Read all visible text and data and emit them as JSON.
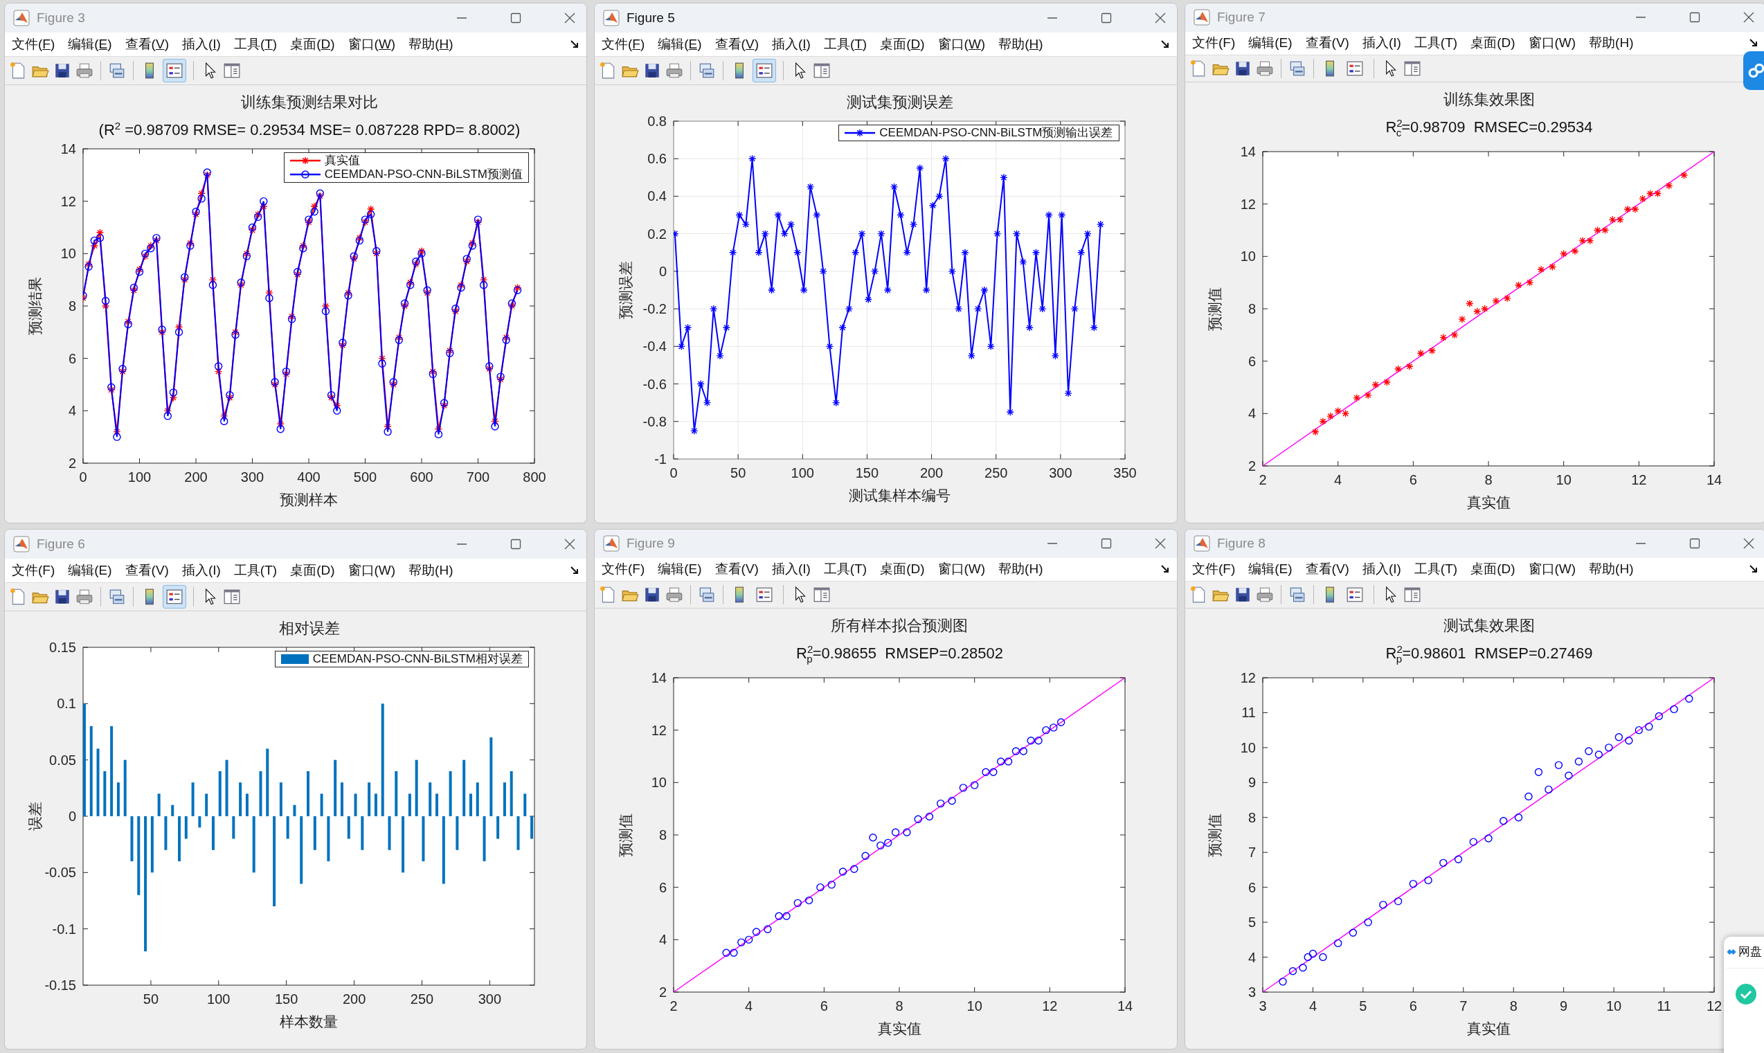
{
  "windows": [
    {
      "title": "Figure 3",
      "active": false,
      "menu_underlined": true,
      "legend_button_selected": true,
      "menu": [
        "文件(F)",
        "编辑(E)",
        "查看(V)",
        "插入(I)",
        "工具(T)",
        "桌面(D)",
        "窗口(W)",
        "帮助(H)"
      ],
      "chart_data": {
        "type": "line",
        "title": "训练集预测结果对比",
        "subtitle": "(R$^{2}$ =0.98709 RMSE= 0.29534 MSE= 0.087228 RPD= 8.8002)",
        "xlabel": "预测样本",
        "ylabel": "预测结果",
        "xlim": [
          0,
          800
        ],
        "ylim": [
          2,
          14
        ],
        "xticks": [
          0,
          100,
          200,
          300,
          400,
          500,
          600,
          700,
          800
        ],
        "yticks": [
          2,
          4,
          6,
          8,
          10,
          12,
          14
        ],
        "grid": false,
        "x": [
          0,
          10,
          20,
          30,
          40,
          50,
          60,
          70,
          80,
          90,
          100,
          110,
          120,
          130,
          140,
          150,
          160,
          170,
          180,
          190,
          200,
          210,
          220,
          230,
          240,
          250,
          260,
          270,
          280,
          290,
          300,
          310,
          320,
          330,
          340,
          350,
          360,
          370,
          380,
          390,
          400,
          410,
          420,
          430,
          440,
          450,
          460,
          470,
          480,
          490,
          500,
          510,
          520,
          530,
          540,
          550,
          560,
          570,
          580,
          590,
          600,
          610,
          620,
          630,
          640,
          650,
          660,
          670,
          680,
          690,
          700,
          710,
          720,
          730,
          740,
          750,
          760,
          770
        ],
        "series": [
          {
            "name": "真实值",
            "color": "#ff0000",
            "marker": "cross",
            "values": [
              8.3,
              9.6,
              10.3,
              10.8,
              8.0,
              4.8,
              3.2,
              5.5,
              7.4,
              8.6,
              9.4,
              9.9,
              10.3,
              10.5,
              7.0,
              4.0,
              4.5,
              7.2,
              9.0,
              10.4,
              11.5,
              12.3,
              13.0,
              9.0,
              5.5,
              3.8,
              4.5,
              7.0,
              8.8,
              10.0,
              10.9,
              11.5,
              11.8,
              8.5,
              5.0,
              3.5,
              5.4,
              7.6,
              9.2,
              10.3,
              11.2,
              11.8,
              12.2,
              8.0,
              4.5,
              4.2,
              6.5,
              8.5,
              9.8,
              10.6,
              11.2,
              11.7,
              10.0,
              6.0,
              3.4,
              5.0,
              6.8,
              8.0,
              8.9,
              9.6,
              10.1,
              8.5,
              5.5,
              3.3,
              4.2,
              6.3,
              7.8,
              8.8,
              9.7,
              10.4,
              11.2,
              9.0,
              5.6,
              3.6,
              5.2,
              6.8,
              8.0,
              8.7
            ]
          },
          {
            "name": "CEEMDAN-PSO-CNN-BiLSTM预测值",
            "color": "#0000ff",
            "marker": "circle",
            "values": [
              8.4,
              9.5,
              10.5,
              10.6,
              8.2,
              4.9,
              3.0,
              5.6,
              7.3,
              8.7,
              9.3,
              10.0,
              10.2,
              10.6,
              7.1,
              3.8,
              4.7,
              7.0,
              9.1,
              10.3,
              11.6,
              12.1,
              13.1,
              8.8,
              5.7,
              3.6,
              4.6,
              6.9,
              8.9,
              9.9,
              11.0,
              11.4,
              12.0,
              8.3,
              5.1,
              3.3,
              5.5,
              7.5,
              9.3,
              10.2,
              11.3,
              11.6,
              12.3,
              7.8,
              4.6,
              4.0,
              6.6,
              8.4,
              9.9,
              10.5,
              11.3,
              11.5,
              10.1,
              5.8,
              3.2,
              5.1,
              6.7,
              8.1,
              8.8,
              9.7,
              10.0,
              8.6,
              5.4,
              3.1,
              4.3,
              6.2,
              7.9,
              8.7,
              9.8,
              10.3,
              11.3,
              8.8,
              5.7,
              3.4,
              5.3,
              6.7,
              8.1,
              8.6
            ]
          }
        ]
      }
    },
    {
      "title": "Figure 5",
      "active": true,
      "menu_underlined": true,
      "legend_button_selected": true,
      "menu": [
        "文件(F)",
        "编辑(E)",
        "查看(V)",
        "插入(I)",
        "工具(T)",
        "桌面(D)",
        "窗口(W)",
        "帮助(H)"
      ],
      "chart_data": {
        "type": "line",
        "title": "测试集预测误差",
        "xlabel": "测试集样本编号",
        "ylabel": "预测误差",
        "xlim": [
          0,
          350
        ],
        "ylim": [
          -1,
          0.8
        ],
        "xticks": [
          0,
          50,
          100,
          150,
          200,
          250,
          300,
          350
        ],
        "yticks": [
          -1,
          -0.8,
          -0.6,
          -0.4,
          -0.2,
          0,
          0.2,
          0.4,
          0.6,
          0.8
        ],
        "grid": true,
        "x": [
          1,
          6,
          11,
          16,
          21,
          26,
          31,
          36,
          41,
          46,
          51,
          56,
          61,
          66,
          71,
          76,
          81,
          86,
          91,
          96,
          101,
          106,
          111,
          116,
          121,
          126,
          131,
          136,
          141,
          146,
          151,
          156,
          161,
          166,
          171,
          176,
          181,
          186,
          191,
          196,
          201,
          206,
          211,
          216,
          221,
          226,
          231,
          236,
          241,
          246,
          251,
          256,
          261,
          266,
          271,
          276,
          281,
          286,
          291,
          296,
          301,
          306,
          311,
          316,
          321,
          326,
          331
        ],
        "series": [
          {
            "name": "CEEMDAN-PSO-CNN-BiLSTM预测输出误差",
            "color": "#0000ff",
            "marker": "cross",
            "values": [
              0.2,
              -0.4,
              -0.3,
              -0.85,
              -0.6,
              -0.7,
              -0.2,
              -0.45,
              -0.3,
              0.1,
              0.3,
              0.25,
              0.6,
              0.1,
              0.2,
              -0.1,
              0.3,
              0.2,
              0.25,
              0.1,
              -0.1,
              0.45,
              0.3,
              0.0,
              -0.4,
              -0.7,
              -0.3,
              -0.2,
              0.1,
              0.2,
              -0.15,
              0.0,
              0.2,
              -0.1,
              0.45,
              0.3,
              0.1,
              0.25,
              0.55,
              -0.1,
              0.35,
              0.4,
              0.6,
              0.0,
              -0.2,
              0.1,
              -0.45,
              -0.2,
              -0.1,
              -0.4,
              0.2,
              0.5,
              -0.75,
              0.2,
              0.05,
              -0.3,
              0.1,
              -0.2,
              0.3,
              -0.45,
              0.3,
              -0.65,
              -0.2,
              0.1,
              0.2,
              -0.3,
              0.25
            ]
          }
        ]
      }
    },
    {
      "title": "Figure 7",
      "active": false,
      "menu_underlined": false,
      "legend_button_selected": false,
      "menu": [
        "文件(F)",
        "编辑(E)",
        "查看(V)",
        "插入(I)",
        "工具(T)",
        "桌面(D)",
        "窗口(W)",
        "帮助(H)"
      ],
      "chart_data": {
        "type": "scatter",
        "title": "训练集效果图",
        "subtitle": "R$^{2}$$_{c}$=0.98709  RMSEC=0.29534",
        "xlabel": "真实值",
        "ylabel": "预测值",
        "xlim": [
          2,
          14
        ],
        "ylim": [
          2,
          14
        ],
        "xticks": [
          2,
          4,
          6,
          8,
          10,
          12,
          14
        ],
        "yticks": [
          2,
          4,
          6,
          8,
          10,
          12,
          14
        ],
        "grid": false,
        "x": [
          3.4,
          3.6,
          3.8,
          4.0,
          4.2,
          4.5,
          4.8,
          5.0,
          5.3,
          5.6,
          5.9,
          6.2,
          6.5,
          6.8,
          7.1,
          7.3,
          7.5,
          7.7,
          7.9,
          8.2,
          8.5,
          8.8,
          9.1,
          9.4,
          9.7,
          10.0,
          10.3,
          10.5,
          10.7,
          10.9,
          11.1,
          11.3,
          11.5,
          11.7,
          11.9,
          12.1,
          12.3,
          12.5,
          12.8,
          13.2
        ],
        "series": [
          {
            "color": "#ff0000",
            "marker": "cross",
            "values": [
              3.3,
              3.7,
              3.9,
              4.1,
              4.0,
              4.6,
              4.7,
              5.1,
              5.2,
              5.7,
              5.8,
              6.3,
              6.4,
              6.9,
              7.0,
              7.6,
              8.2,
              7.9,
              8.0,
              8.3,
              8.4,
              8.9,
              9.0,
              9.5,
              9.6,
              10.1,
              10.2,
              10.6,
              10.6,
              11.0,
              11.0,
              11.4,
              11.4,
              11.8,
              11.8,
              12.2,
              12.4,
              12.4,
              12.7,
              13.1
            ]
          },
          {
            "type": "line",
            "color": "#ff00ff",
            "marker": "none",
            "x": [
              2,
              14
            ],
            "values": [
              2,
              14
            ]
          }
        ]
      }
    },
    {
      "title": "Figure 6",
      "active": false,
      "menu_underlined": false,
      "legend_button_selected": true,
      "menu": [
        "文件(F)",
        "编辑(E)",
        "查看(V)",
        "插入(I)",
        "工具(T)",
        "桌面(D)",
        "窗口(W)",
        "帮助(H)"
      ],
      "chart_data": {
        "type": "bar",
        "title": "相对误差",
        "xlabel": "样本数量",
        "ylabel": "误差",
        "xlim": [
          0,
          333
        ],
        "ylim": [
          -0.15,
          0.15
        ],
        "xticks": [
          50,
          100,
          150,
          200,
          250,
          300
        ],
        "yticks": [
          -0.15,
          -0.1,
          -0.05,
          0,
          0.05,
          0.1,
          0.15
        ],
        "grid": false,
        "x": [
          1,
          6,
          11,
          16,
          21,
          26,
          31,
          36,
          41,
          46,
          51,
          56,
          61,
          66,
          71,
          76,
          81,
          86,
          91,
          96,
          101,
          106,
          111,
          116,
          121,
          126,
          131,
          136,
          141,
          146,
          151,
          156,
          161,
          166,
          171,
          176,
          181,
          186,
          191,
          196,
          201,
          206,
          211,
          216,
          221,
          226,
          231,
          236,
          241,
          246,
          251,
          256,
          261,
          266,
          271,
          276,
          281,
          286,
          291,
          296,
          301,
          306,
          311,
          316,
          321,
          326,
          331
        ],
        "series": [
          {
            "name": "CEEMDAN-PSO-CNN-BiLSTM相对误差",
            "color": "#0072bd",
            "values": [
              0.1,
              0.08,
              0.06,
              0.04,
              0.08,
              0.03,
              0.05,
              -0.04,
              -0.07,
              -0.12,
              -0.05,
              0.02,
              -0.03,
              0.01,
              -0.04,
              -0.02,
              0.03,
              -0.01,
              0.02,
              -0.03,
              0.04,
              0.05,
              -0.02,
              0.03,
              0.02,
              -0.05,
              0.04,
              0.06,
              -0.08,
              0.03,
              -0.02,
              0.01,
              -0.06,
              0.04,
              -0.03,
              0.02,
              -0.04,
              0.05,
              0.03,
              -0.02,
              0.02,
              -0.03,
              0.03,
              0.02,
              0.1,
              -0.03,
              0.04,
              -0.05,
              0.02,
              0.05,
              -0.04,
              0.03,
              0.02,
              -0.06,
              0.04,
              -0.03,
              0.05,
              0.02,
              0.03,
              -0.04,
              0.07,
              -0.02,
              0.03,
              0.04,
              -0.03,
              0.02,
              -0.02
            ]
          }
        ]
      }
    },
    {
      "title": "Figure 9",
      "active": false,
      "menu_underlined": false,
      "legend_button_selected": false,
      "menu": [
        "文件(F)",
        "编辑(E)",
        "查看(V)",
        "插入(I)",
        "工具(T)",
        "桌面(D)",
        "窗口(W)",
        "帮助(H)"
      ],
      "chart_data": {
        "type": "scatter",
        "title": "所有样本拟合预测图",
        "subtitle": "R$^{2}$$_{p}$=0.98655  RMSEP=0.28502",
        "xlabel": "真实值",
        "ylabel": "预测值",
        "xlim": [
          2,
          14
        ],
        "ylim": [
          2,
          14
        ],
        "xticks": [
          2,
          4,
          6,
          8,
          10,
          12,
          14
        ],
        "yticks": [
          2,
          4,
          6,
          8,
          10,
          12,
          14
        ],
        "grid": false,
        "x": [
          3.4,
          3.6,
          3.8,
          4.0,
          4.2,
          4.5,
          4.8,
          5.0,
          5.3,
          5.6,
          5.9,
          6.2,
          6.5,
          6.8,
          7.1,
          7.3,
          7.5,
          7.7,
          7.9,
          8.2,
          8.5,
          8.8,
          9.1,
          9.4,
          9.7,
          10.0,
          10.3,
          10.5,
          10.7,
          10.9,
          11.1,
          11.3,
          11.5,
          11.7,
          11.9,
          12.1,
          12.3
        ],
        "series": [
          {
            "color": "#0000ff",
            "marker": "circle",
            "values": [
              3.5,
              3.5,
              3.9,
              4.0,
              4.3,
              4.4,
              4.9,
              4.9,
              5.4,
              5.5,
              6.0,
              6.1,
              6.6,
              6.7,
              7.2,
              7.9,
              7.6,
              7.7,
              8.1,
              8.1,
              8.6,
              8.7,
              9.2,
              9.3,
              9.8,
              9.9,
              10.4,
              10.4,
              10.8,
              10.8,
              11.2,
              11.2,
              11.6,
              11.6,
              12.0,
              12.1,
              12.3
            ]
          },
          {
            "type": "line",
            "color": "#ff00ff",
            "marker": "none",
            "x": [
              2,
              14
            ],
            "values": [
              2,
              14
            ]
          }
        ]
      }
    },
    {
      "title": "Figure 8",
      "active": false,
      "menu_underlined": false,
      "legend_button_selected": false,
      "menu": [
        "文件(F)",
        "编辑(E)",
        "查看(V)",
        "插入(I)",
        "工具(T)",
        "桌面(D)",
        "窗口(W)",
        "帮助(H)"
      ],
      "chart_data": {
        "type": "scatter",
        "title": "测试集效果图",
        "subtitle": "R$^{2}$$_{p}$=0.98601  RMSEP=0.27469",
        "xlabel": "真实值",
        "ylabel": "预测值",
        "xlim": [
          3,
          12
        ],
        "ylim": [
          3,
          12
        ],
        "xticks": [
          3,
          4,
          5,
          6,
          7,
          8,
          9,
          10,
          11,
          12
        ],
        "yticks": [
          3,
          4,
          5,
          6,
          7,
          8,
          9,
          10,
          11,
          12
        ],
        "grid": false,
        "x": [
          3.4,
          3.6,
          3.8,
          3.9,
          4.0,
          4.2,
          4.5,
          4.8,
          5.1,
          5.4,
          5.7,
          6.0,
          6.3,
          6.6,
          6.9,
          7.2,
          7.5,
          7.8,
          8.1,
          8.3,
          8.5,
          8.7,
          8.9,
          9.1,
          9.3,
          9.5,
          9.7,
          9.9,
          10.1,
          10.3,
          10.5,
          10.7,
          10.9,
          11.2,
          11.5
        ],
        "series": [
          {
            "color": "#0000ff",
            "marker": "circle",
            "values": [
              3.3,
              3.6,
              3.7,
              4.0,
              4.1,
              4.0,
              4.4,
              4.7,
              5.0,
              5.5,
              5.6,
              6.1,
              6.2,
              6.7,
              6.8,
              7.3,
              7.4,
              7.9,
              8.0,
              8.6,
              9.3,
              8.8,
              9.5,
              9.2,
              9.6,
              9.9,
              9.8,
              10.0,
              10.3,
              10.2,
              10.5,
              10.6,
              10.9,
              11.1,
              11.4
            ]
          },
          {
            "type": "line",
            "color": "#ff00ff",
            "marker": "none",
            "x": [
              3,
              12
            ],
            "values": [
              3,
              12
            ]
          }
        ]
      }
    }
  ],
  "notification": {
    "title": "网盘"
  }
}
